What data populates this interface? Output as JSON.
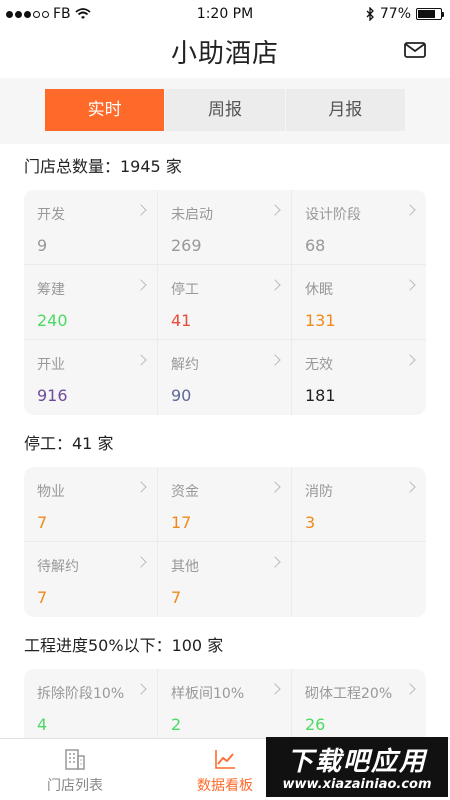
{
  "statusbar": {
    "carrier": "FB",
    "time": "1:20 PM",
    "battery": "77%",
    "battery_level": 0.77
  },
  "header": {
    "title": "小助酒店"
  },
  "tabs": [
    {
      "label": "实时",
      "active": true
    },
    {
      "label": "周报",
      "active": false
    },
    {
      "label": "月报",
      "active": false
    }
  ],
  "sections": [
    {
      "title": "门店总数量：1945 家",
      "cells": [
        {
          "label": "开发",
          "value": "9",
          "color": "#999999"
        },
        {
          "label": "未启动",
          "value": "269",
          "color": "#999999"
        },
        {
          "label": "设计阶段",
          "value": "68",
          "color": "#999999"
        },
        {
          "label": "筹建",
          "value": "240",
          "color": "#4cd964"
        },
        {
          "label": "停工",
          "value": "41",
          "color": "#e84c3d"
        },
        {
          "label": "休眠",
          "value": "131",
          "color": "#f08a1d"
        },
        {
          "label": "开业",
          "value": "916",
          "color": "#6e4a9e"
        },
        {
          "label": "解约",
          "value": "90",
          "color": "#5d6a98"
        },
        {
          "label": "无效",
          "value": "181",
          "color": "#222222"
        }
      ]
    },
    {
      "title": "停工：41 家",
      "cells": [
        {
          "label": "物业",
          "value": "7",
          "color": "#f08a1d"
        },
        {
          "label": "资金",
          "value": "17",
          "color": "#f08a1d"
        },
        {
          "label": "消防",
          "value": "3",
          "color": "#f08a1d"
        },
        {
          "label": "待解约",
          "value": "7",
          "color": "#f08a1d"
        },
        {
          "label": "其他",
          "value": "7",
          "color": "#f08a1d"
        }
      ]
    },
    {
      "title": "工程进度50%以下：100 家",
      "cells": [
        {
          "label": "拆除阶段10%",
          "value": "4",
          "color": "#4cd964"
        },
        {
          "label": "样板间10%",
          "value": "2",
          "color": "#4cd964"
        },
        {
          "label": "砌体工程20%",
          "value": "26",
          "color": "#4cd964"
        }
      ]
    }
  ],
  "bottomnav": [
    {
      "label": "门店列表",
      "icon": "building-icon",
      "active": false
    },
    {
      "label": "数据看板",
      "icon": "chart-icon",
      "active": true
    }
  ],
  "watermark": {
    "main": "下载吧应用",
    "sub": "www.xiazainiao.com"
  },
  "colors": {
    "accent": "#ff6a2b"
  }
}
